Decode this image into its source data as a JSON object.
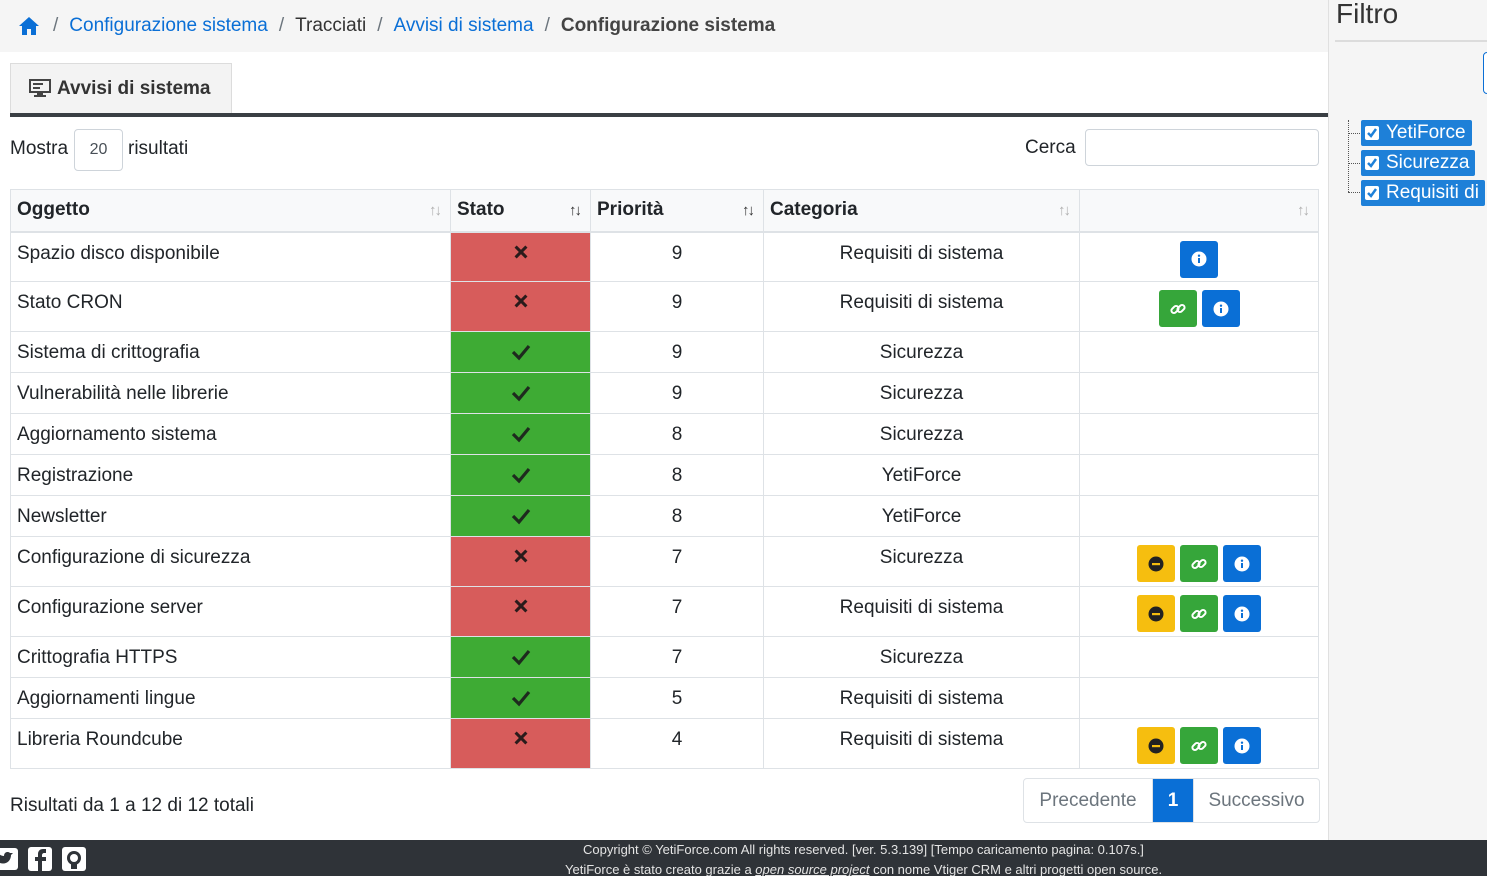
{
  "breadcrumb": {
    "home_icon": "home-icon",
    "items": [
      "Configurazione sistema",
      "Tracciati",
      "Avvisi di sistema",
      "Configurazione sistema"
    ],
    "separator": "/"
  },
  "tab": {
    "label": "Avvisi di sistema",
    "icon": "monitor-icon"
  },
  "controls": {
    "show_label": "Mostra",
    "page_size": "20",
    "show_suffix": "risultati",
    "search_label": "Cerca",
    "search_value": ""
  },
  "table": {
    "headers": [
      "Oggetto",
      "Stato",
      "Priorità",
      "Categoria",
      ""
    ],
    "rows": [
      {
        "obj": "Spazio disco disponibile",
        "ok": false,
        "prio": "9",
        "cat": "Requisiti di sistema",
        "actions": [
          "info"
        ]
      },
      {
        "obj": "Stato CRON",
        "ok": false,
        "prio": "9",
        "cat": "Requisiti di sistema",
        "actions": [
          "link",
          "info"
        ]
      },
      {
        "obj": "Sistema di crittografia",
        "ok": true,
        "prio": "9",
        "cat": "Sicurezza",
        "actions": []
      },
      {
        "obj": "Vulnerabilità nelle librerie",
        "ok": true,
        "prio": "9",
        "cat": "Sicurezza",
        "actions": []
      },
      {
        "obj": "Aggiornamento sistema",
        "ok": true,
        "prio": "8",
        "cat": "Sicurezza",
        "actions": []
      },
      {
        "obj": "Registrazione",
        "ok": true,
        "prio": "8",
        "cat": "YetiForce",
        "actions": []
      },
      {
        "obj": "Newsletter",
        "ok": true,
        "prio": "8",
        "cat": "YetiForce",
        "actions": []
      },
      {
        "obj": "Configurazione di sicurezza",
        "ok": false,
        "prio": "7",
        "cat": "Sicurezza",
        "actions": [
          "ignore",
          "link",
          "info"
        ]
      },
      {
        "obj": "Configurazione server",
        "ok": false,
        "prio": "7",
        "cat": "Requisiti di sistema",
        "actions": [
          "ignore",
          "link",
          "info"
        ]
      },
      {
        "obj": "Crittografia HTTPS",
        "ok": true,
        "prio": "7",
        "cat": "Sicurezza",
        "actions": []
      },
      {
        "obj": "Aggiornamenti lingue",
        "ok": true,
        "prio": "5",
        "cat": "Requisiti di sistema",
        "actions": []
      },
      {
        "obj": "Libreria Roundcube",
        "ok": false,
        "prio": "4",
        "cat": "Requisiti di sistema",
        "actions": [
          "ignore",
          "link",
          "info"
        ]
      }
    ]
  },
  "summary": "Risultati da 1 a 12 di 12 totali",
  "pagination": {
    "prev": "Precedente",
    "current": "1",
    "next": "Successivo"
  },
  "footer": {
    "line1": "Copyright © YetiForce.com All rights reserved. [ver. 5.3.139] [Tempo caricamento pagina: 0.107s.]",
    "line2_pre": "YetiForce è stato creato grazie a ",
    "line2_link": "open source project",
    "line2_post": " con nome Vtiger CRM e altri progetti open source."
  },
  "filter": {
    "title": "Filtro",
    "items": [
      "YetiForce",
      "Sicurezza",
      "Requisiti di"
    ]
  },
  "colors": {
    "ok": "#3eab34",
    "ko": "#d75c5b",
    "primary": "#0a6fd6",
    "success": "#36a63a",
    "warning": "#f6be0f"
  }
}
